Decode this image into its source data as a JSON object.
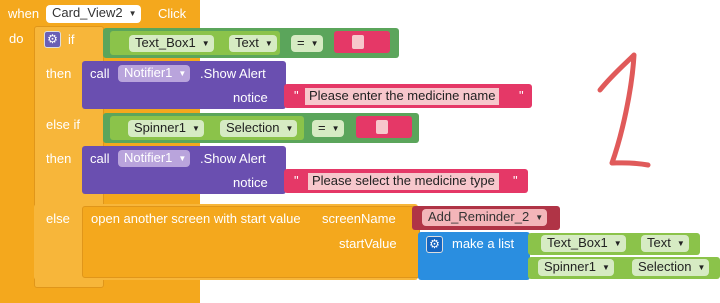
{
  "event": {
    "when": "when",
    "component": "Card_View2",
    "event_name": "Click",
    "do": "do"
  },
  "if_block": {
    "if_label": "if",
    "then_label": "then",
    "elseif_label": "else if",
    "else_label": "else"
  },
  "cond1": {
    "component": "Text_Box1",
    "property": "Text",
    "operator": "="
  },
  "call1": {
    "call": "call",
    "component": "Notifier1",
    "method": ".Show Alert",
    "param": "notice",
    "message": "Please enter the medicine name"
  },
  "cond2": {
    "component": "Spinner1",
    "property": "Selection",
    "operator": "="
  },
  "call2": {
    "call": "call",
    "component": "Notifier1",
    "method": ".Show Alert",
    "param": "notice",
    "message": "Please select the medicine type"
  },
  "open_screen": {
    "label": "open another screen with start value",
    "screen_param": "screenName",
    "screen_value": "Add_Reminder_2",
    "start_param": "startValue"
  },
  "make_list": {
    "label": "make a list",
    "item1": {
      "component": "Text_Box1",
      "property": "Text"
    },
    "item2": {
      "component": "Spinner1",
      "property": "Selection"
    }
  },
  "annotation": {
    "text": "1",
    "color": "#e05a5a"
  },
  "colors": {
    "control": "#f4a81d",
    "text_block": "#e53867",
    "logic": "#5ba55b",
    "procedure": "#6a4fb0",
    "component_green": "#8bc34a",
    "list": "#2a8ee0",
    "component_red": "#b03446"
  }
}
